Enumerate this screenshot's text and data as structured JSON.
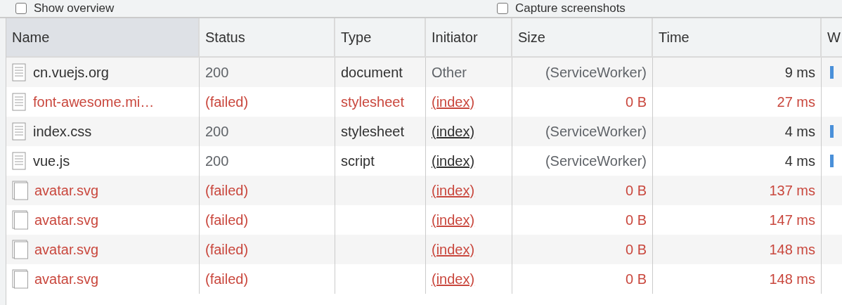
{
  "options": [
    {
      "label": "Show overview",
      "checked": false
    },
    {
      "label": "Capture screenshots",
      "checked": false
    }
  ],
  "table": {
    "columns": [
      {
        "label": "Name",
        "sorted": true
      },
      {
        "label": "Status",
        "sorted": false
      },
      {
        "label": "Type",
        "sorted": false
      },
      {
        "label": "Initiator",
        "sorted": false
      },
      {
        "label": "Size",
        "sorted": false
      },
      {
        "label": "Time",
        "sorted": false
      },
      {
        "label": "W",
        "sorted": false
      }
    ],
    "rows": [
      {
        "kind": "lined",
        "name": "cn.vuejs.org",
        "status": "200",
        "type": "document",
        "initiator": "Other",
        "initiator_link": false,
        "size": "(ServiceWorker)",
        "time": "9 ms",
        "failed": false,
        "bar": true
      },
      {
        "kind": "lined",
        "name": "font-awesome.mi…",
        "status": "(failed)",
        "type": "stylesheet",
        "initiator": "(index)",
        "initiator_link": true,
        "size": "0 B",
        "time": "27 ms",
        "failed": true,
        "bar": false
      },
      {
        "kind": "lined",
        "name": "index.css",
        "status": "200",
        "type": "stylesheet",
        "initiator": "(index)",
        "initiator_link": true,
        "size": "(ServiceWorker)",
        "time": "4 ms",
        "failed": false,
        "bar": true
      },
      {
        "kind": "lined",
        "name": "vue.js",
        "status": "200",
        "type": "script",
        "initiator": "(index)",
        "initiator_link": true,
        "size": "(ServiceWorker)",
        "time": "4 ms",
        "failed": false,
        "bar": true
      },
      {
        "kind": "blank",
        "name": "avatar.svg",
        "status": "(failed)",
        "initiator": "(index)",
        "initiator_link": true,
        "size": "0 B",
        "time": "137 ms",
        "failed": true,
        "bar": false
      },
      {
        "kind": "blank",
        "name": "avatar.svg",
        "status": "(failed)",
        "initiator": "(index)",
        "initiator_link": true,
        "size": "0 B",
        "time": "147 ms",
        "failed": true,
        "bar": false
      },
      {
        "kind": "blank",
        "name": "avatar.svg",
        "status": "(failed)",
        "initiator": "(index)",
        "initiator_link": true,
        "size": "0 B",
        "time": "148 ms",
        "failed": true,
        "bar": false
      },
      {
        "kind": "blank",
        "name": "avatar.svg",
        "status": "(failed)",
        "initiator": "(index)",
        "initiator_link": true,
        "size": "0 B",
        "time": "148 ms",
        "failed": true,
        "bar": false
      }
    ]
  }
}
